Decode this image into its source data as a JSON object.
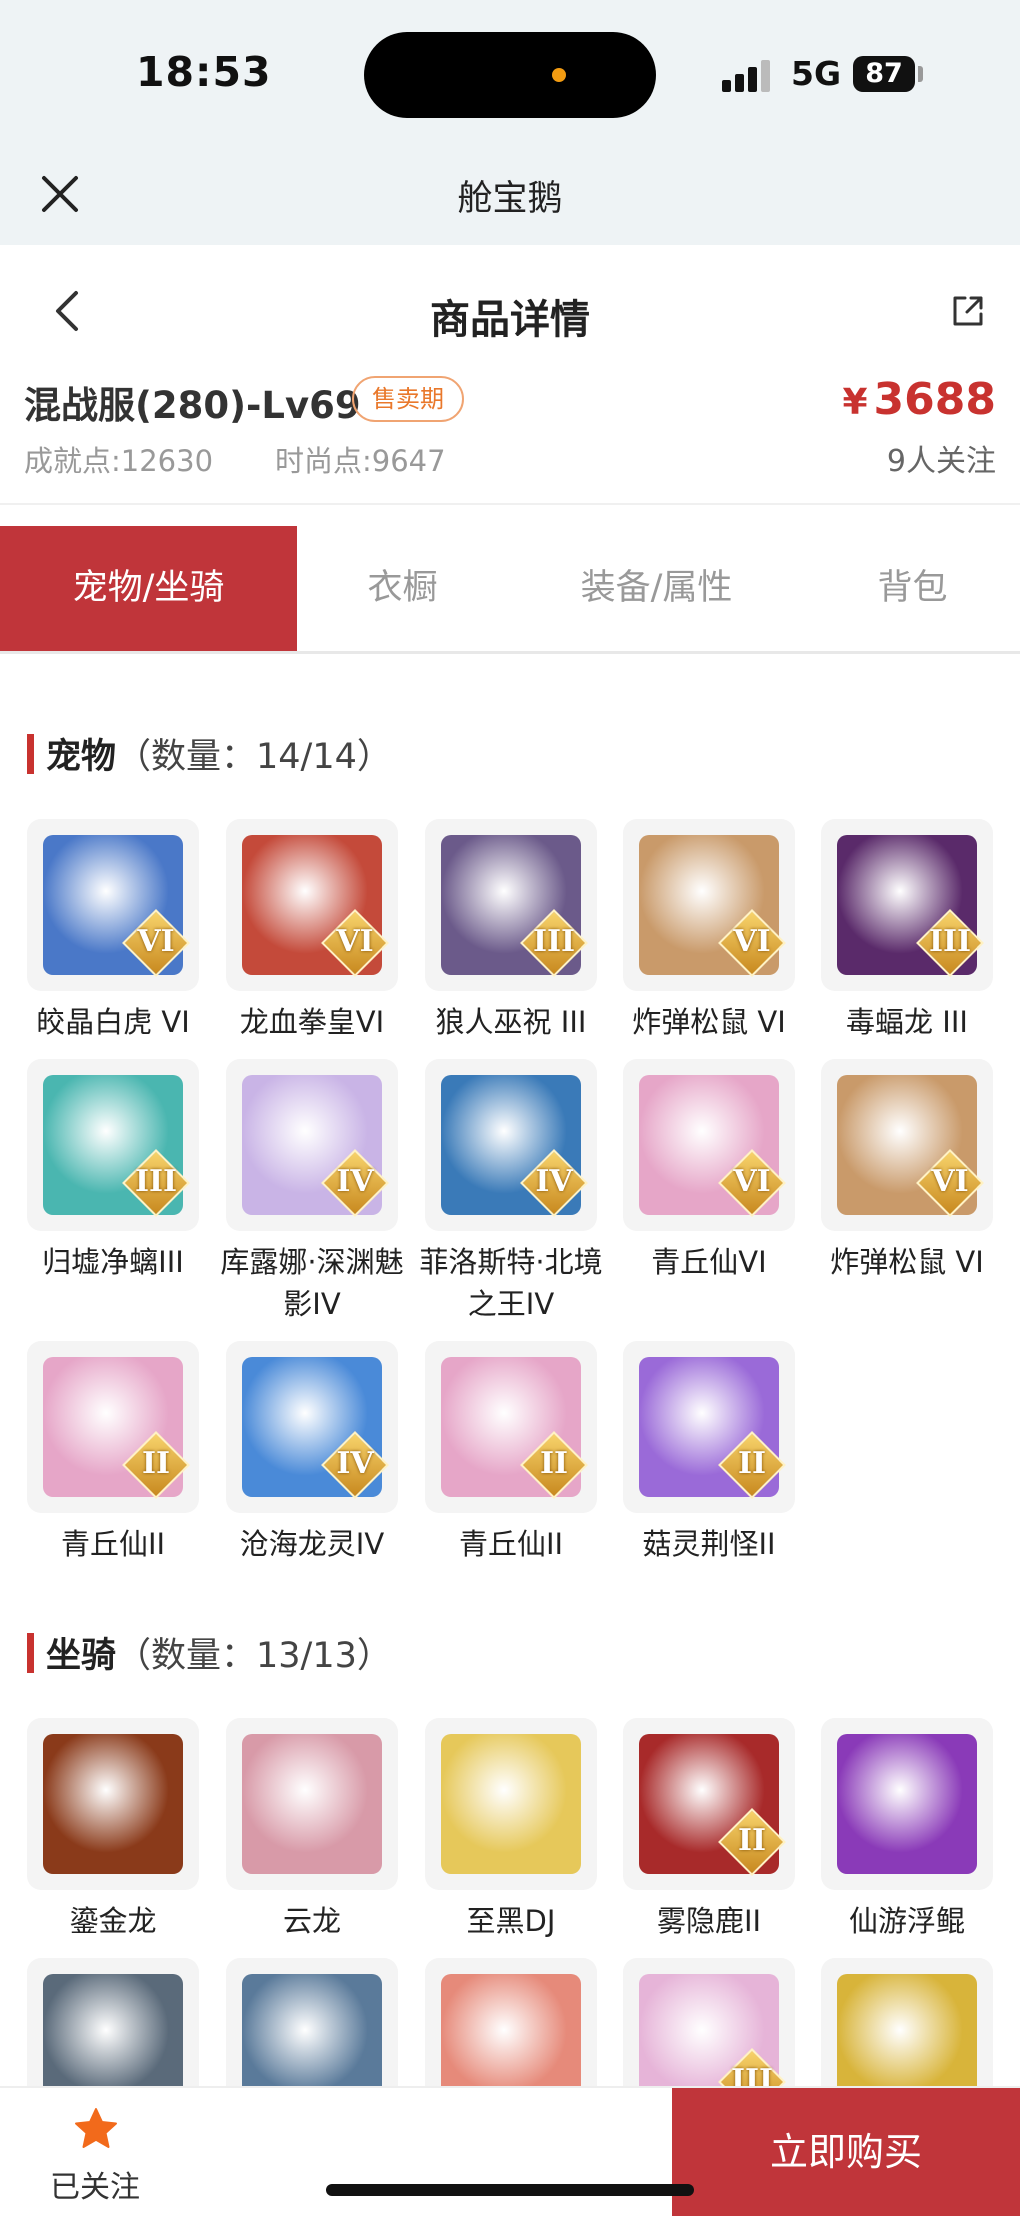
{
  "status_bar": {
    "time": "18:53",
    "network": "5G",
    "battery": "87"
  },
  "miniapp": {
    "title": "舱宝鹅"
  },
  "header": {
    "title": "商品详情"
  },
  "product": {
    "name": "混战服(280)-Lv69",
    "badge": "售卖期",
    "price_symbol": "¥",
    "price": "3688",
    "achievement": "成就点:12630",
    "fashion": "时尚点:9647",
    "followers": "9人关注"
  },
  "tabs": [
    "宠物/坐骑",
    "衣橱",
    "装备/属性",
    "背包"
  ],
  "pets_section": {
    "title": "宠物",
    "count": "（数量：14/14）"
  },
  "pets": [
    {
      "name": "皎晶白虎 VI",
      "rank": "VI",
      "color": "#4a78c8"
    },
    {
      "name": "龙血拳皇VI",
      "rank": "VI",
      "color": "#c44a3a"
    },
    {
      "name": "狼人巫祝 III",
      "rank": "III",
      "color": "#6b5a8a"
    },
    {
      "name": "炸弹松鼠 VI",
      "rank": "VI",
      "color": "#c99a6a"
    },
    {
      "name": "毒蝠龙 III",
      "rank": "III",
      "color": "#5a2a6a"
    },
    {
      "name": "归墟净螭III",
      "rank": "III",
      "color": "#4ab6b0"
    },
    {
      "name": "库露娜·深渊魅影IV",
      "rank": "IV",
      "color": "#c9b4e6"
    },
    {
      "name": "菲洛斯特·北境之王IV",
      "rank": "IV",
      "color": "#3a7ab8"
    },
    {
      "name": "青丘仙VI",
      "rank": "VI",
      "color": "#e6a6c8"
    },
    {
      "name": "炸弹松鼠 VI",
      "rank": "VI",
      "color": "#c99a6a"
    },
    {
      "name": "青丘仙II",
      "rank": "II",
      "color": "#e6a6c8"
    },
    {
      "name": "沧海龙灵IV",
      "rank": "IV",
      "color": "#4a8ad8"
    },
    {
      "name": "青丘仙II",
      "rank": "II",
      "color": "#e6a6c8"
    },
    {
      "name": "菇灵荆怪II",
      "rank": "II",
      "color": "#9a6ad8"
    }
  ],
  "mounts_section": {
    "title": "坐骑",
    "count": "（数量：13/13）"
  },
  "mounts": [
    {
      "name": "鎏金龙",
      "rank": "",
      "color": "#8a3a1a"
    },
    {
      "name": "云龙",
      "rank": "",
      "color": "#d89aa8"
    },
    {
      "name": "至黑DJ",
      "rank": "",
      "color": "#e6c85a"
    },
    {
      "name": "雾隐鹿II",
      "rank": "II",
      "color": "#a82a2a"
    },
    {
      "name": "仙游浮鲲",
      "rank": "",
      "color": "#8a3ab8"
    },
    {
      "name": "",
      "rank": "",
      "color": "#5a6a7a"
    },
    {
      "name": "",
      "rank": "",
      "color": "#5a7a9a"
    },
    {
      "name": "",
      "rank": "",
      "color": "#e68a7a"
    },
    {
      "name": "",
      "rank": "III",
      "color": "#e6b4d8"
    },
    {
      "name": "",
      "rank": "",
      "color": "#d8b43a"
    }
  ],
  "bottom_bar": {
    "follow_label": "已关注",
    "buy_label": "立即购买"
  },
  "colors": {
    "accent": "#c0353a",
    "price": "#c8322f",
    "badge": "#e9782b"
  }
}
